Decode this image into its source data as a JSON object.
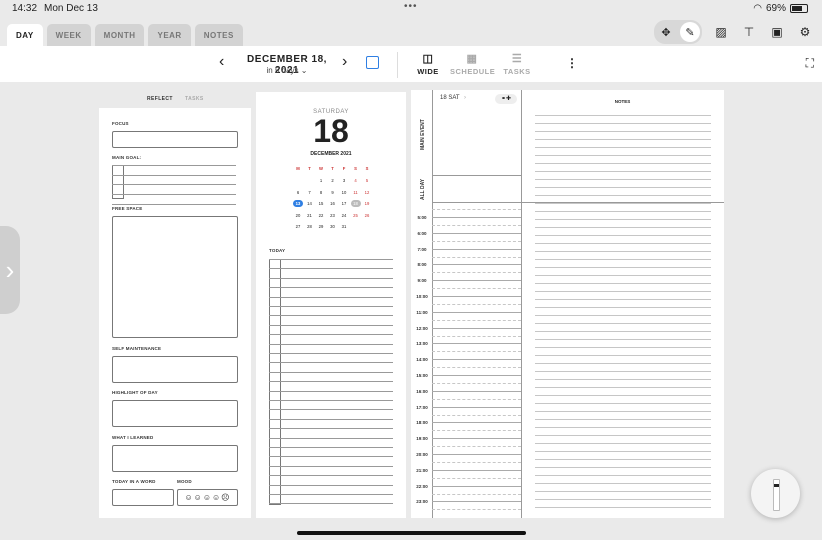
{
  "status": {
    "time": "14:32",
    "date": "Mon Dec 13",
    "battery": "69%",
    "battery_level": 0.69
  },
  "tabs": [
    "DAY",
    "WEEK",
    "MONTH",
    "YEAR",
    "NOTES"
  ],
  "header": {
    "date": "DECEMBER 18, 2021",
    "sub": "in 5 days",
    "views": [
      "WIDE",
      "SCHEDULE",
      "TASKS"
    ]
  },
  "reflect": {
    "tabs": [
      "REFLECT",
      "TASKS"
    ],
    "focus": "FOCUS",
    "main_goal": "MAIN GOAL:",
    "free_space": "FREE SPACE",
    "self_maintenance": "SELF MAINTENANCE",
    "highlight": "HIGHLIGHT OF DAY",
    "learned": "WHAT I LEARNED",
    "word": "TODAY IN A WORD",
    "mood": "MOOD",
    "mood_faces": "☺☺☺☺☹"
  },
  "day": {
    "weekday": "SATURDAY",
    "day": "18",
    "monthyear": "DECEMBER 2021",
    "dow": [
      "M",
      "T",
      "W",
      "T",
      "F",
      "S",
      "S"
    ],
    "weeks": [
      [
        "",
        "",
        "1",
        "2",
        "3",
        "4",
        "5"
      ],
      [
        "6",
        "7",
        "8",
        "9",
        "10",
        "11",
        "12"
      ],
      [
        "13",
        "14",
        "15",
        "16",
        "17",
        "18",
        "19"
      ],
      [
        "20",
        "21",
        "22",
        "23",
        "24",
        "25",
        "26"
      ],
      [
        "27",
        "28",
        "29",
        "30",
        "31",
        "",
        ""
      ]
    ],
    "selected_day": "13",
    "marked_day": "18",
    "today_label": "TODAY"
  },
  "schedule": {
    "day_label": "18 SAT",
    "main_event": "MAIN EVENT",
    "all_day": "ALL DAY",
    "notes": "NOTES",
    "times": [
      "5:00",
      "6:00",
      "7:00",
      "8:00",
      "9:00",
      "10:00",
      "11:00",
      "12:00",
      "13:00",
      "14:00",
      "15:00",
      "16:00",
      "17:00",
      "18:00",
      "19:00",
      "20:00",
      "21:00",
      "22:00",
      "23:00"
    ]
  }
}
